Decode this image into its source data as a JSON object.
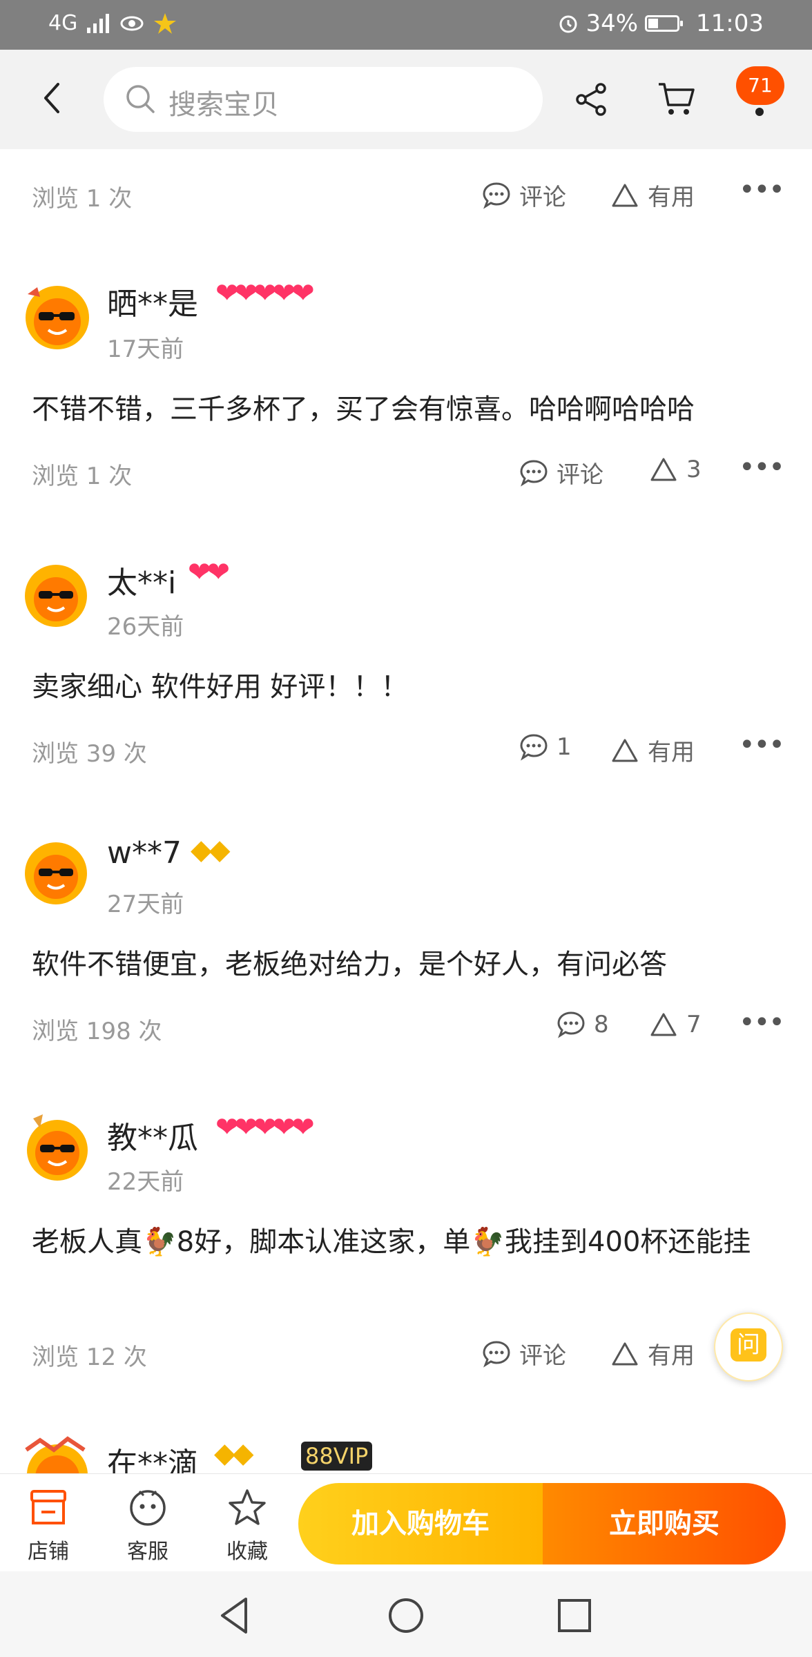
{
  "status_bar": {
    "network": "4G",
    "battery": "34%",
    "battery_level": 0.34,
    "time": "11:03"
  },
  "header": {
    "search_placeholder": "搜索宝贝",
    "message_badge": "71"
  },
  "top_row": {
    "views": "浏览 1 次",
    "comment_label": "评论",
    "useful_label": "有用"
  },
  "reviews": [
    {
      "name": "晒**是",
      "badge": "❤❤❤❤❤",
      "time": "17天前",
      "text": "不错不错，三千多杯了，买了会有惊喜。哈哈啊哈哈哈",
      "views": "浏览 1 次",
      "comment": "评论",
      "useful": "3"
    },
    {
      "name": "太**i",
      "badge": "❤❤",
      "time": "26天前",
      "text": "卖家细心 软件好用 好评！！！",
      "views": "浏览 39 次",
      "comment": "1",
      "useful": "有用"
    },
    {
      "name": "w**7",
      "badge": "◆◆",
      "time": "27天前",
      "text": "软件不错便宜，老板绝对给力，是个好人，有问必答",
      "views": "浏览 198 次",
      "comment": "8",
      "useful": "7"
    },
    {
      "name": "教**瓜",
      "badge": "❤❤❤❤❤",
      "time": "22天前",
      "text": "老板人真🐓8好，脚本认准这家，单🐓我挂到400杯还能挂",
      "views": "浏览 12 次",
      "comment": "评论",
      "useful": "有用"
    },
    {
      "name": "在**滴",
      "badge": "◆◆",
      "vip": "88VIP"
    }
  ],
  "fab": {
    "label": "问"
  },
  "bottom_bar": {
    "store": "店铺",
    "service": "客服",
    "favorite": "收藏",
    "add_to_cart": "加入购物车",
    "buy_now": "立即购买"
  },
  "colors": {
    "accent": "#ff5000",
    "cart_button": "#ffc400",
    "status_bar": "#808080"
  }
}
